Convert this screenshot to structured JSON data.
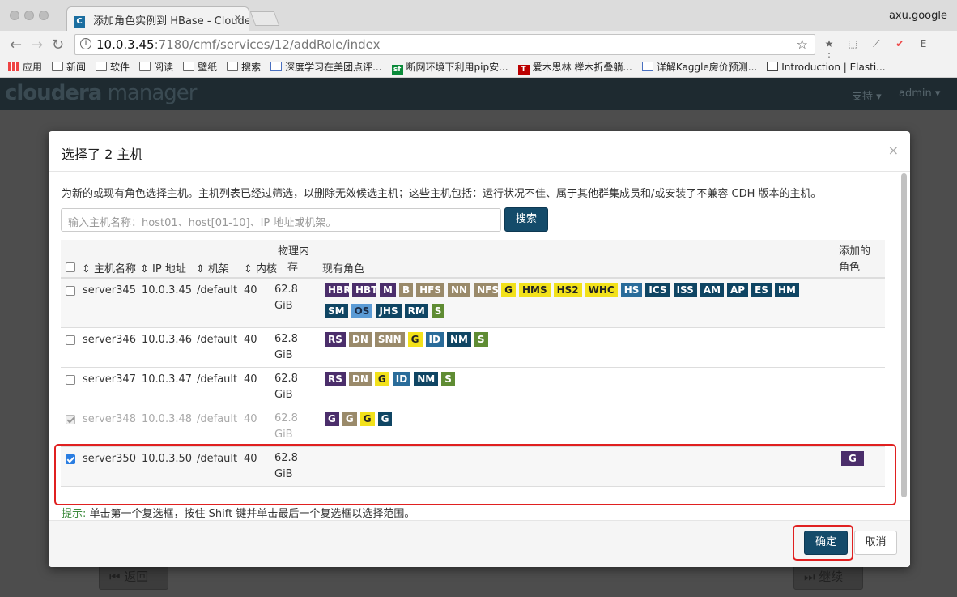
{
  "browser": {
    "tab_title": "添加角色实例到 HBase - Cloudera",
    "tab_favicon": "C",
    "profile": "axu.google",
    "url_host": "10.0.3.45",
    "url_path": ":7180/cmf/services/12/addRole/index",
    "bookmarks": [
      {
        "icon": "apps-grid-icon",
        "label": "应用"
      },
      {
        "icon": "folder-icon",
        "label": "新闻"
      },
      {
        "icon": "folder-icon",
        "label": "软件"
      },
      {
        "icon": "folder-icon",
        "label": "阅读"
      },
      {
        "icon": "folder-icon",
        "label": "壁纸"
      },
      {
        "icon": "folder-icon",
        "label": "搜索"
      },
      {
        "icon": "chart-icon",
        "label": "深度学习在美团点评..."
      },
      {
        "icon": "sf-icon",
        "label": "断网环境下利用pip安..."
      },
      {
        "icon": "t-icon",
        "label": "爱木思林 榉木折叠躺..."
      },
      {
        "icon": "chart-icon",
        "label": "详解Kaggle房价预测..."
      },
      {
        "icon": "book-icon",
        "label": "Introduction | Elasti..."
      }
    ]
  },
  "app": {
    "logo_a": "cloudera",
    "logo_b": " manager",
    "menu_support": "支持 ▾",
    "menu_admin": "admin ▾",
    "back_label": "返回",
    "continue_label": "继续"
  },
  "modal": {
    "title": "选择了 2 主机",
    "close": "×",
    "description": "为新的或现有角色选择主机。主机列表已经过筛选，以删除无效候选主机；这些主机包括：运行状况不佳、属于其他群集成员和/或安装了不兼容 CDH 版本的主机。",
    "search_placeholder": "输入主机名称：host01、host[01-10]、IP 地址或机架。",
    "search_button": "搜索",
    "columns": {
      "hostname": "主机名称",
      "ip": "IP 地址",
      "rack": "机架",
      "cores": "内核",
      "memory_a": "物理内",
      "memory_b": "存",
      "existing_roles": "现有角色",
      "added_roles_a": "添加的",
      "added_roles_b": "角色"
    },
    "hosts": [
      {
        "name": "server345",
        "ip": "10.0.3.45",
        "rack": "/default",
        "cores": "40",
        "mem_a": "62.8",
        "mem_b": "GiB",
        "roles": [
          "HBRE",
          "HBTS",
          "M",
          "B",
          "HFS",
          "NN",
          "NFSG",
          "G",
          "HMS",
          "HS2",
          "WHC",
          "HS",
          "ICS",
          "ISS",
          "AM",
          "AP",
          "ES",
          "HM",
          "SM",
          "OS",
          "JHS",
          "RM",
          "S"
        ]
      },
      {
        "name": "server346",
        "ip": "10.0.3.46",
        "rack": "/default",
        "cores": "40",
        "mem_a": "62.8",
        "mem_b": "GiB",
        "roles": [
          "RS",
          "DN",
          "SNN",
          "G",
          "ID",
          "NM",
          "S"
        ]
      },
      {
        "name": "server347",
        "ip": "10.0.3.47",
        "rack": "/default",
        "cores": "40",
        "mem_a": "62.8",
        "mem_b": "GiB",
        "roles": [
          "RS",
          "DN",
          "G",
          "ID",
          "NM",
          "S"
        ]
      },
      {
        "name": "server348",
        "ip": "10.0.3.48",
        "rack": "/default",
        "cores": "40",
        "mem_a": "62.8",
        "mem_b": "GiB",
        "roles": [
          "G",
          "G",
          "G",
          "G"
        ]
      },
      {
        "name": "server350",
        "ip": "10.0.3.50",
        "rack": "/default",
        "cores": "40",
        "mem_a": "62.8",
        "mem_b": "GiB",
        "roles": [],
        "added": "G"
      }
    ],
    "hint_label": "提示:",
    "hint_text": " 单击第一个复选框，按住 Shift 键并单击最后一个复选框以选择范围。",
    "ok_button": "确定",
    "cancel_button": "取消"
  },
  "colors": {
    "primary_button": "#144b6a",
    "highlight_box": "#e02020"
  }
}
